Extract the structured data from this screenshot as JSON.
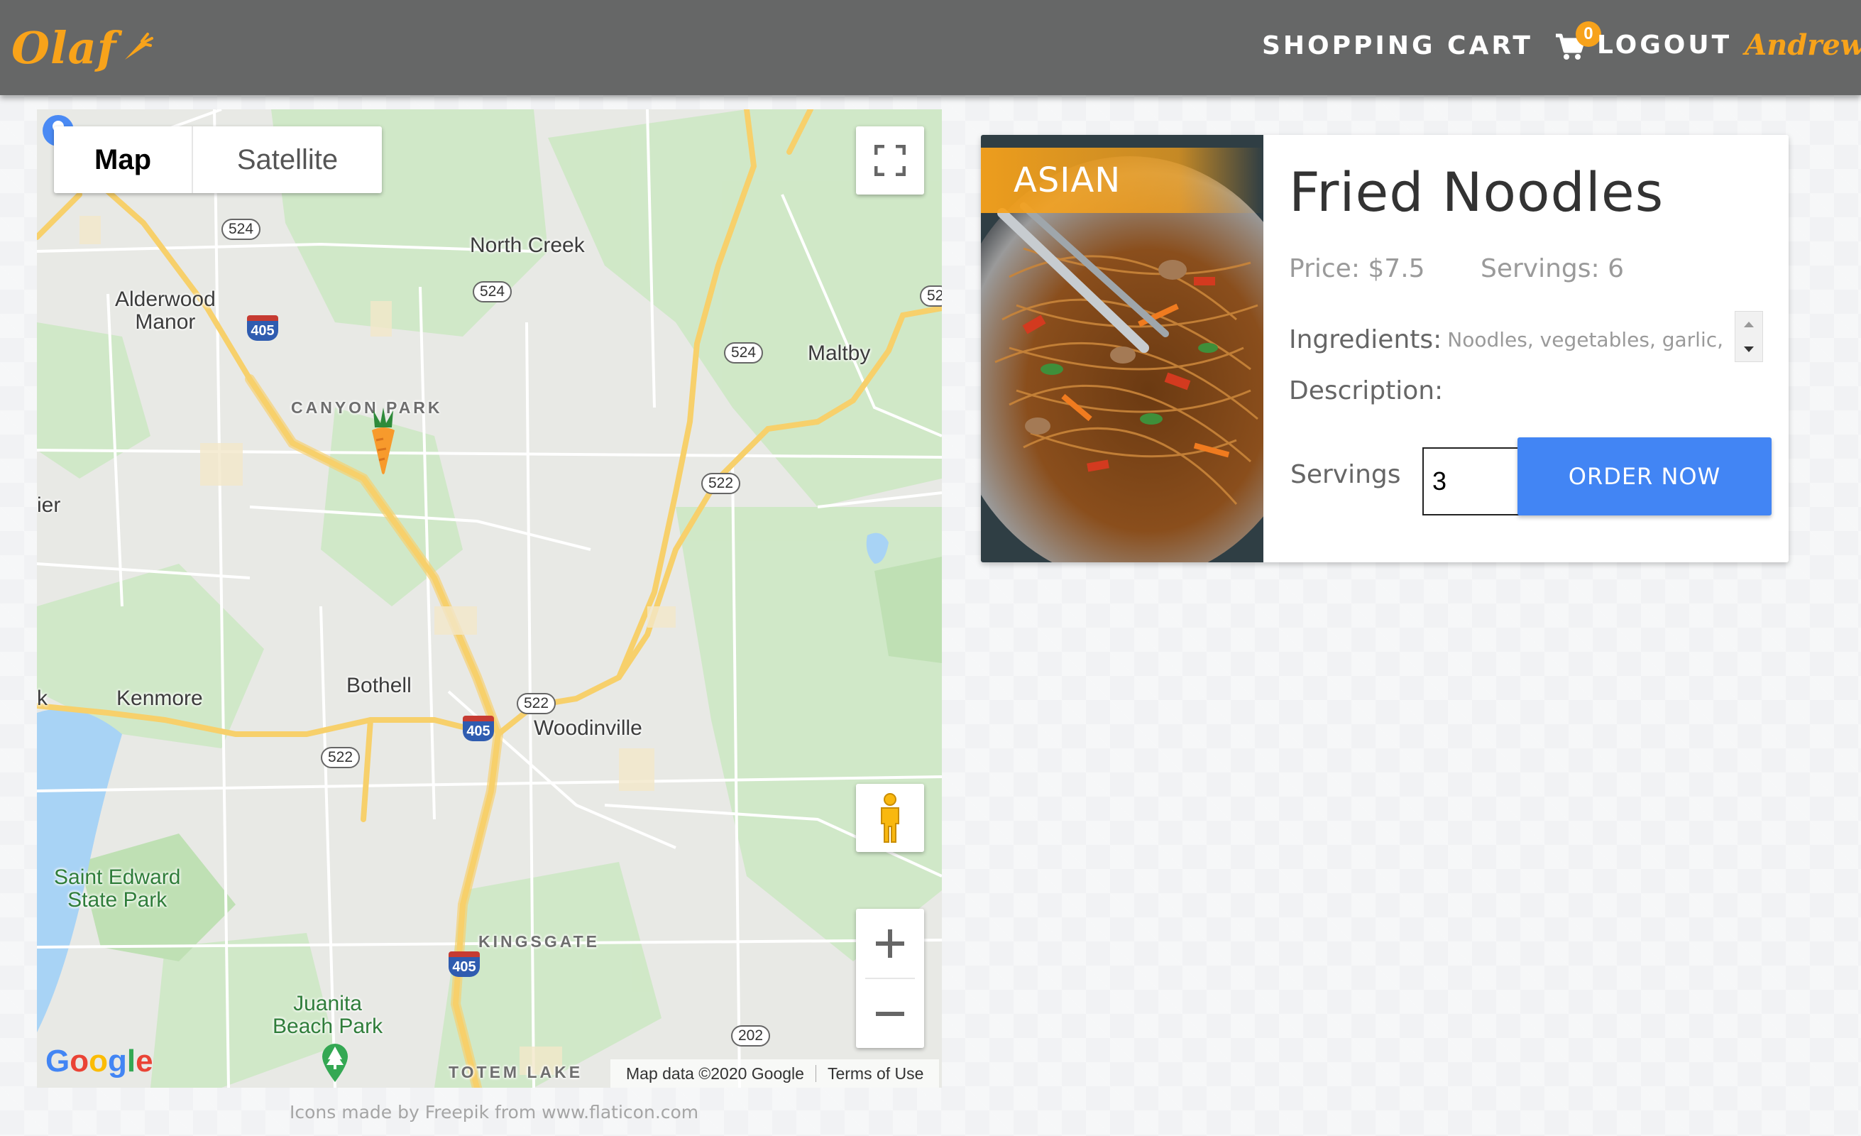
{
  "brand": {
    "name": "Olaf"
  },
  "nav": {
    "cart_label": "SHOPPING CART",
    "cart_count": "0",
    "logout_label": "LOGOUT",
    "username": "Andrew"
  },
  "map": {
    "type_map": "Map",
    "type_satellite": "Satellite",
    "labels": {
      "north_creek": "North Creek",
      "alderwood_manor": "Alderwood\nManor",
      "maltby": "Maltby",
      "canyon_park": "CANYON PARK",
      "kenmore": "Kenmore",
      "bothell": "Bothell",
      "woodinville": "Woodinville",
      "saint_edward": "Saint Edward\nState Park",
      "kingsgate": "KINGSGATE",
      "juanita": "Juanita\nBeach Park",
      "totem_lake": "TOTEM LAKE",
      "edge_left_1": "ier",
      "edge_left_2": "k"
    },
    "shields": {
      "r524_a": "524",
      "r524_b": "524",
      "r524_c": "524",
      "r522_a": "522",
      "r522_b": "522",
      "r522_c": "522",
      "r202": "202",
      "r52": "52",
      "i405_a": "405",
      "i405_b": "405",
      "i405_c": "405"
    },
    "google_text": "Google",
    "map_data": "Map data ©2020 Google",
    "terms": "Terms of Use"
  },
  "credits": "Icons made by Freepik from www.flaticon.com",
  "dish": {
    "category": "ASIAN",
    "title": "Fried Noodles",
    "price": "Price: $7.5",
    "servings_available": "Servings: 6",
    "ingredients_label": "Ingredients:",
    "ingredients_value": "Noodles, vegetables, garlic,",
    "description_label": "Description:",
    "servings_label": "Servings",
    "servings_value": "3",
    "order_button": "ORDER NOW"
  },
  "colors": {
    "brand_orange": "#f8a31a",
    "navbar": "#666767",
    "order_button": "#4285f4"
  }
}
